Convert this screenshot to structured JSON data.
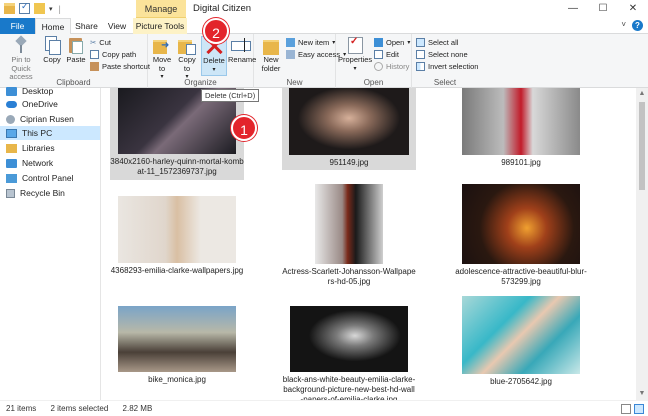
{
  "window": {
    "title": "Digital Citizen",
    "manage_tab": "Manage",
    "controls": {
      "minimize": "—",
      "maximize": "☐",
      "close": "✕"
    }
  },
  "tabs": {
    "file": "File",
    "home": "Home",
    "share": "Share",
    "view": "View",
    "picture_tools": "Picture Tools",
    "collapse": "˅"
  },
  "ribbon": {
    "clipboard": {
      "pin_label": "Pin to Quick access",
      "copy_label": "Copy",
      "paste_label": "Paste",
      "cut_label": "Cut",
      "copy_path_label": "Copy path",
      "paste_shortcut_label": "Paste shortcut",
      "group_label": "Clipboard"
    },
    "organize": {
      "move_to_label": "Move to",
      "copy_to_label": "Copy to",
      "delete_label": "Delete",
      "rename_label": "Rename",
      "group_label": "Organize"
    },
    "new": {
      "new_folder_label": "New folder",
      "new_item_label": "New item",
      "easy_access_label": "Easy access",
      "group_label": "New"
    },
    "open": {
      "properties_label": "Properties",
      "open_label": "Open",
      "edit_label": "Edit",
      "history_label": "History",
      "group_label": "Open"
    },
    "select": {
      "select_all_label": "Select all",
      "select_none_label": "Select none",
      "invert_label": "Invert selection",
      "group_label": "Select"
    }
  },
  "tooltip": "Delete (Ctrl+D)",
  "callouts": [
    "1",
    "2"
  ],
  "nav": {
    "items": [
      {
        "label": "Desktop",
        "icon": "desktop-icon"
      },
      {
        "label": "OneDrive",
        "icon": "onedrive-icon"
      },
      {
        "label": "Ciprian Rusen",
        "icon": "user-icon"
      },
      {
        "label": "This PC",
        "icon": "pc-icon"
      },
      {
        "label": "Libraries",
        "icon": "libraries-icon"
      },
      {
        "label": "Network",
        "icon": "network-icon"
      },
      {
        "label": "Control Panel",
        "icon": "control-panel-icon"
      },
      {
        "label": "Recycle Bin",
        "icon": "recycle-bin-icon"
      }
    ]
  },
  "files": [
    {
      "name": "3840x2160-harley-quinn-mortal-kombat-11_1572369737.jpg",
      "selected": true
    },
    {
      "name": "951149.jpg",
      "selected": true
    },
    {
      "name": "989101.jpg",
      "selected": false
    },
    {
      "name": "4368293-emilia-clarke-wallpapers.jpg",
      "selected": false
    },
    {
      "name": "Actress-Scarlett-Johansson-Wallpapers-hd-05.jpg",
      "selected": false
    },
    {
      "name": "adolescence-attractive-beautiful-blur-573299.jpg",
      "selected": false
    },
    {
      "name": "bike_monica.jpg",
      "selected": false
    },
    {
      "name": "black-ans-white-beauty-emilia-clarke-background-picture-new-best-hd-wall-papers-of-emilia-clarke.jpg",
      "selected": false
    },
    {
      "name": "blue-2705642.jpg",
      "selected": false
    }
  ],
  "status": {
    "items_count": "21 items",
    "selected": "2 items selected",
    "size": "2.82 MB"
  }
}
